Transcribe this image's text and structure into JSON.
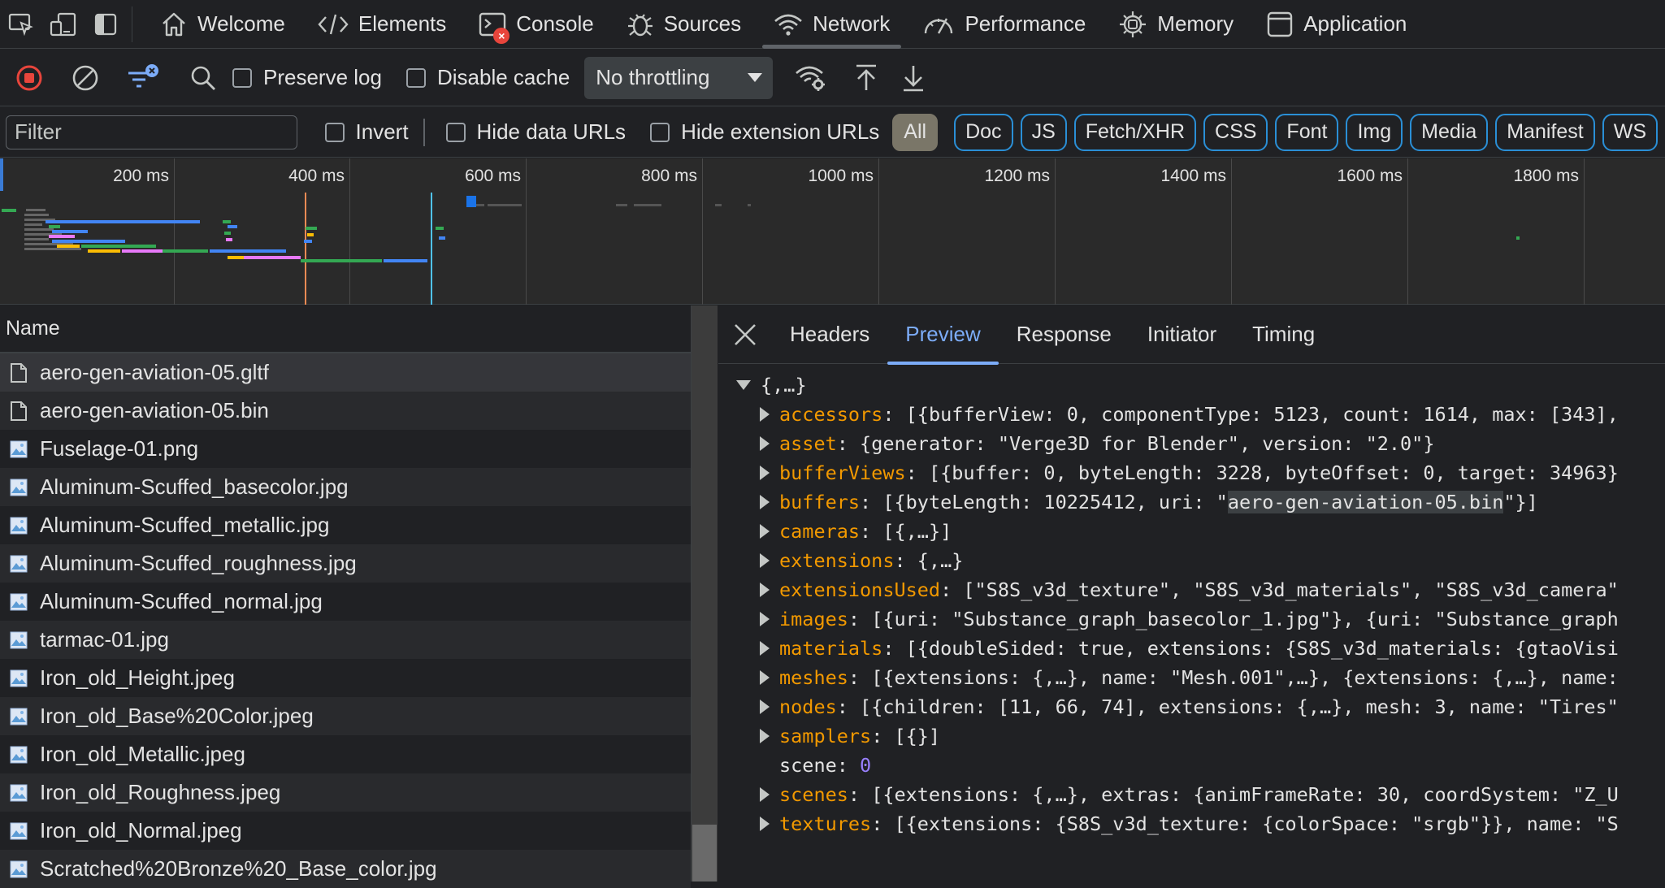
{
  "tabs": [
    {
      "id": "welcome",
      "label": "Welcome",
      "icon": "home-icon"
    },
    {
      "id": "elements",
      "label": "Elements",
      "icon": "code-icon"
    },
    {
      "id": "console",
      "label": "Console",
      "icon": "terminal-icon",
      "badge": "×"
    },
    {
      "id": "sources",
      "label": "Sources",
      "icon": "bug-icon"
    },
    {
      "id": "network",
      "label": "Network",
      "icon": "wifi-icon",
      "active": true
    },
    {
      "id": "performance",
      "label": "Performance",
      "icon": "gauge-icon"
    },
    {
      "id": "memory",
      "label": "Memory",
      "icon": "chip-icon"
    },
    {
      "id": "application",
      "label": "Application",
      "icon": "window-icon"
    }
  ],
  "toolbar": {
    "preserve_log": "Preserve log",
    "disable_cache": "Disable cache",
    "throttling": "No throttling"
  },
  "filter": {
    "placeholder": "Filter",
    "invert": "Invert",
    "hide_data_urls": "Hide data URLs",
    "hide_extension_urls": "Hide extension URLs",
    "types": [
      "All",
      "Doc",
      "JS",
      "Fetch/XHR",
      "CSS",
      "Font",
      "Img",
      "Media",
      "Manifest",
      "WS"
    ]
  },
  "overview": {
    "ticks": [
      "200 ms",
      "400 ms",
      "600 ms",
      "800 ms",
      "1000 ms",
      "1200 ms",
      "1400 ms",
      "1600 ms",
      "1800 ms"
    ]
  },
  "requests": {
    "header": "Name",
    "items": [
      {
        "name": "aero-gen-aviation-05.gltf",
        "type": "doc"
      },
      {
        "name": "aero-gen-aviation-05.bin",
        "type": "doc"
      },
      {
        "name": "Fuselage-01.png",
        "type": "img"
      },
      {
        "name": "Aluminum-Scuffed_basecolor.jpg",
        "type": "img"
      },
      {
        "name": "Aluminum-Scuffed_metallic.jpg",
        "type": "img"
      },
      {
        "name": "Aluminum-Scuffed_roughness.jpg",
        "type": "img"
      },
      {
        "name": "Aluminum-Scuffed_normal.jpg",
        "type": "img"
      },
      {
        "name": "tarmac-01.jpg",
        "type": "img"
      },
      {
        "name": "Iron_old_Height.jpeg",
        "type": "img"
      },
      {
        "name": "Iron_old_Base%20Color.jpeg",
        "type": "img"
      },
      {
        "name": "Iron_old_Metallic.jpeg",
        "type": "img"
      },
      {
        "name": "Iron_old_Roughness.jpeg",
        "type": "img"
      },
      {
        "name": "Iron_old_Normal.jpeg",
        "type": "img"
      },
      {
        "name": "Scratched%20Bronze%20_Base_color.jpg",
        "type": "img"
      }
    ]
  },
  "detail": {
    "tabs": [
      "Headers",
      "Preview",
      "Response",
      "Initiator",
      "Timing"
    ],
    "root": "{,…}",
    "lines": [
      {
        "key": "accessors",
        "value": " [{bufferView: 0, componentType: 5123, count: 1614, max: [343],"
      },
      {
        "key": "asset",
        "value": " {generator: \"Verge3D for Blender\", version: \"2.0\"}"
      },
      {
        "key": "bufferViews",
        "value": " [{buffer: 0, byteLength: 3228, byteOffset: 0, target: 34963}"
      },
      {
        "key": "buffers",
        "value_pre": " [{byteLength: 10225412, uri: \"",
        "value_hl": "aero-gen-aviation-05.bin",
        "value_post": "\"}]"
      },
      {
        "key": "cameras",
        "value": " [{,…}]"
      },
      {
        "key": "extensions",
        "value": " {,…}"
      },
      {
        "key": "extensionsUsed",
        "value": " [\"S8S_v3d_texture\", \"S8S_v3d_materials\", \"S8S_v3d_camera\""
      },
      {
        "key": "images",
        "value": " [{uri: \"Substance_graph_basecolor_1.jpg\"}, {uri: \"Substance_graph"
      },
      {
        "key": "materials",
        "value": " [{doubleSided: true, extensions: {S8S_v3d_materials: {gtaoVisi"
      },
      {
        "key": "meshes",
        "value": " [{extensions: {,…}, name: \"Mesh.001\",…}, {extensions: {,…}, name:"
      },
      {
        "key": "nodes",
        "value": " [{children: [11, 66, 74], extensions: {,…}, mesh: 3, name: \"Tires\""
      },
      {
        "key": "samplers",
        "value": " [{}]"
      },
      {
        "key": "scene",
        "value": "0",
        "plain": true
      },
      {
        "key": "scenes",
        "value": " [{extensions: {,…}, extras: {animFrameRate: 30, coordSystem: \"Z_U"
      },
      {
        "key": "textures",
        "value": " [{extensions: {S8S_v3d_texture: {colorSpace: \"srgb\"}}, name: \"S"
      }
    ]
  }
}
